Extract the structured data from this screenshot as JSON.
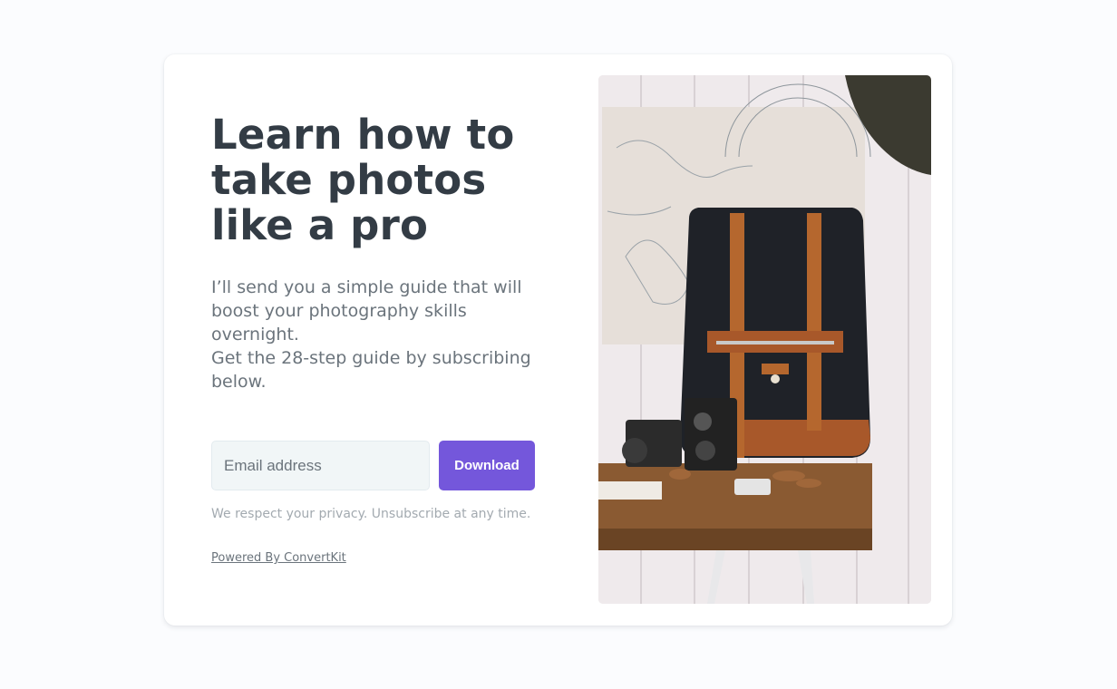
{
  "form": {
    "headline": "Learn how to take photos like a pro",
    "intro": "I’ll send you a simple guide that will boost your photography skills overnight.",
    "offer": "Get the 28-step guide by subscribing below.",
    "email_placeholder": "Email address",
    "email_value": "",
    "submit_label": "Download",
    "privacy_note": "We respect your privacy. Unsubscribe at any time.",
    "powered_by": "Powered By ConvertKit"
  },
  "image": {
    "subject": "black-backpack-with-vintage-cameras-on-wooden-table",
    "alt": ""
  },
  "colors": {
    "page_background": "#fbfcfe",
    "card_background": "#ffffff",
    "headline": "#333c45",
    "body_text": "#6b747c",
    "muted_text": "#a3aab0",
    "input_background": "#f1f6f7",
    "button_background": "#7457db",
    "button_text": "#ffffff"
  }
}
